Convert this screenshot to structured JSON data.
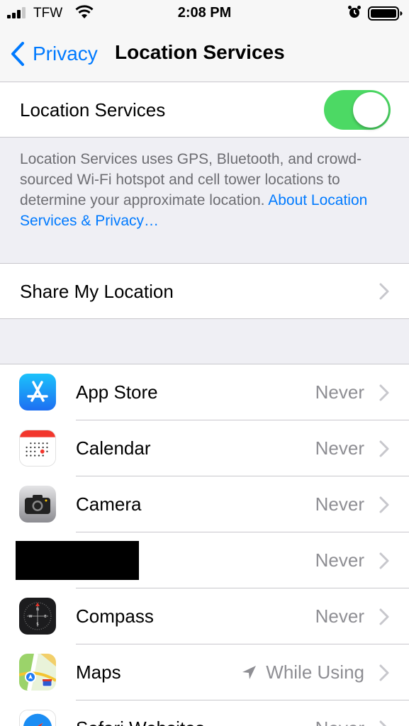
{
  "status_bar": {
    "carrier": "TFW",
    "time": "2:08 PM"
  },
  "nav": {
    "back_label": "Privacy",
    "title": "Location Services"
  },
  "location_toggle": {
    "label": "Location Services",
    "on": true,
    "color": "#4cd964"
  },
  "description": {
    "text": "Location Services uses GPS, Bluetooth, and crowd-sourced Wi-Fi hotspot and cell tower locations to determine your approximate location. ",
    "link": "About Location Services & Privacy…"
  },
  "share": {
    "label": "Share My Location"
  },
  "apps": [
    {
      "name": "App Store",
      "value": "Never",
      "icon": "app-store-icon"
    },
    {
      "name": "Calendar",
      "value": "Never",
      "icon": "calendar-icon"
    },
    {
      "name": "Camera",
      "value": "Never",
      "icon": "camera-icon"
    },
    {
      "name": "",
      "value": "Never",
      "icon": "redacted"
    },
    {
      "name": "Compass",
      "value": "Never",
      "icon": "compass-icon"
    },
    {
      "name": "Maps",
      "value": "While Using",
      "icon": "maps-icon"
    },
    {
      "name": "Safari Websites",
      "value": "Never",
      "icon": "safari-icon"
    }
  ],
  "colors": {
    "accent": "#007aff",
    "secondary_text": "#8e8e93",
    "group_background": "#efeff4"
  }
}
